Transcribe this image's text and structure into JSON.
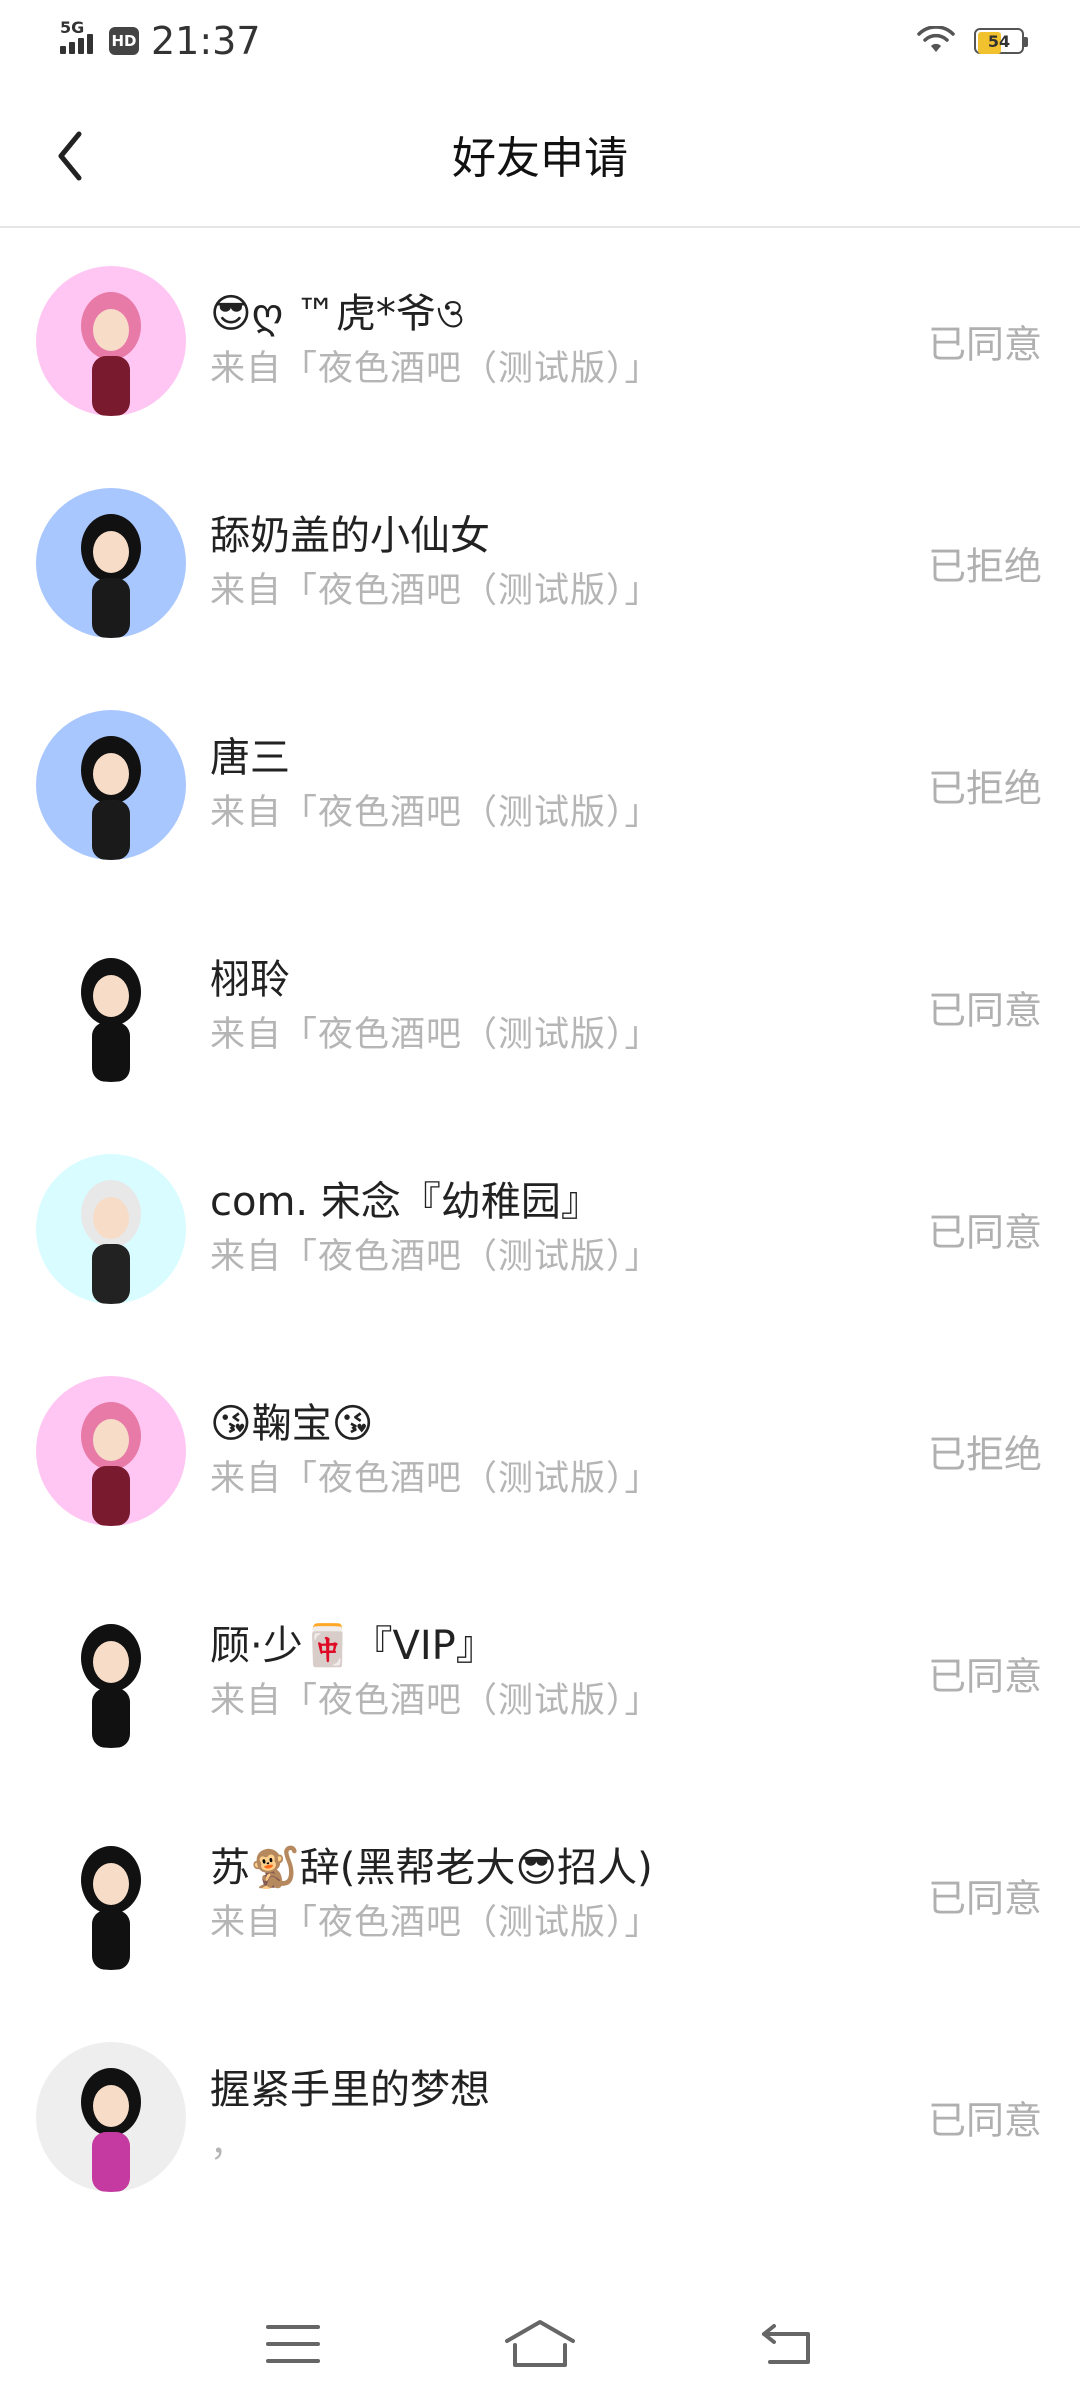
{
  "status_bar": {
    "network": "5G",
    "hd": "HD",
    "time": "21:37",
    "battery_level": "54",
    "battery_fill": 0.54
  },
  "header": {
    "title": "好友申请"
  },
  "colors": {
    "status_text": "#b0b0b0",
    "source_text": "#b5b5b5",
    "battery": "#f2c12e"
  },
  "requests": [
    {
      "name": "😎ღ ™虎*爷ও",
      "source": "来自「夜色酒吧（测试版）」",
      "status": "已同意",
      "avatar": "pink-bg-anime-avatar"
    },
    {
      "name": "舔奶盖的小仙女",
      "source": "来自「夜色酒吧（测试版）」",
      "status": "已拒绝",
      "avatar": "blue-bg-anime-avatar"
    },
    {
      "name": "唐三",
      "source": "来自「夜色酒吧（测试版）」",
      "status": "已拒绝",
      "avatar": "blue-bg-anime-avatar"
    },
    {
      "name": "栩聆",
      "source": "来自「夜色酒吧（测试版）」",
      "status": "已同意",
      "avatar": "white-bg-anime-avatar"
    },
    {
      "name": "com. 宋念『幼稚园』",
      "source": "来自「夜色酒吧（测试版）」",
      "status": "已同意",
      "avatar": "cyan-bg-anime-avatar"
    },
    {
      "name": "😘鞠宝😘",
      "source": "来自「夜色酒吧（测试版）」",
      "status": "已拒绝",
      "avatar": "pink-bg-anime-avatar"
    },
    {
      "name": "顾·少🀄『VIP』",
      "source": "来自「夜色酒吧（测试版）」",
      "status": "已同意",
      "avatar": "white-bg-anime-avatar"
    },
    {
      "name": "苏🐒辞(黑帮老大😎招人)",
      "source": "来自「夜色酒吧（测试版）」",
      "status": "已同意",
      "avatar": "white-bg-anime-avatar"
    },
    {
      "name": "握紧手里的梦想",
      "source": "，",
      "status": "已同意",
      "avatar": "gray-bg-anime-avatar"
    }
  ]
}
